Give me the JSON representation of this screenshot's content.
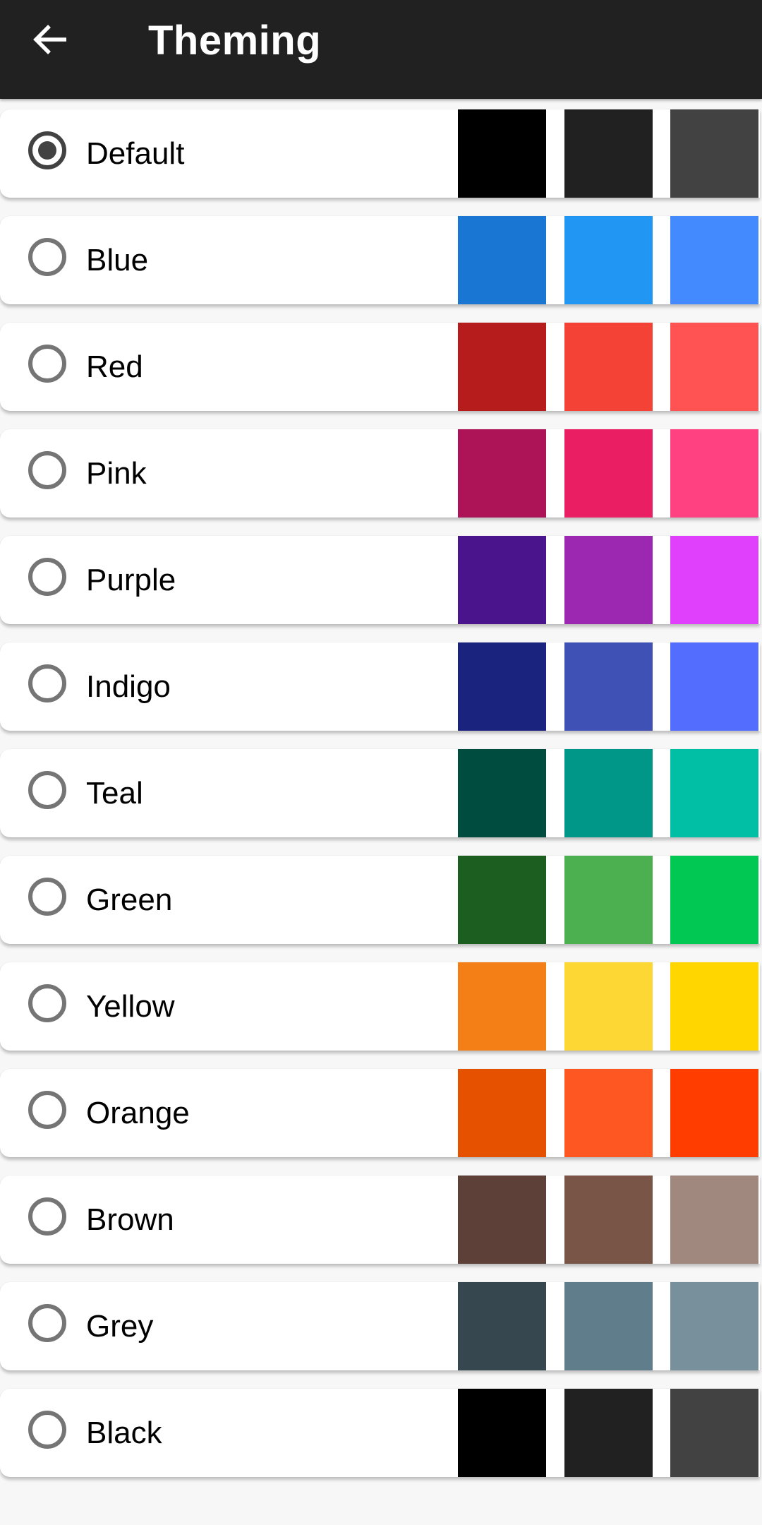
{
  "app_bar": {
    "title": "Theming",
    "back_icon": "arrow-left-icon"
  },
  "selected_theme": "Default",
  "themes": [
    {
      "name": "Default",
      "selected": true,
      "colors": [
        "#000000",
        "#212121",
        "#424242"
      ]
    },
    {
      "name": "Blue",
      "selected": false,
      "colors": [
        "#1976D2",
        "#2196F3",
        "#448AFF"
      ]
    },
    {
      "name": "Red",
      "selected": false,
      "colors": [
        "#B71C1C",
        "#F44336",
        "#FF5252"
      ]
    },
    {
      "name": "Pink",
      "selected": false,
      "colors": [
        "#AD1457",
        "#E91E63",
        "#FF4081"
      ]
    },
    {
      "name": "Purple",
      "selected": false,
      "colors": [
        "#4A148C",
        "#9C27B0",
        "#E040FB"
      ]
    },
    {
      "name": "Indigo",
      "selected": false,
      "colors": [
        "#1A237E",
        "#3F51B5",
        "#536DFE"
      ]
    },
    {
      "name": "Teal",
      "selected": false,
      "colors": [
        "#004D40",
        "#009688",
        "#00BFA5"
      ]
    },
    {
      "name": "Green",
      "selected": false,
      "colors": [
        "#1B5E20",
        "#4CAF50",
        "#00C853"
      ]
    },
    {
      "name": "Yellow",
      "selected": false,
      "colors": [
        "#F57F17",
        "#FDD835",
        "#FFD600"
      ]
    },
    {
      "name": "Orange",
      "selected": false,
      "colors": [
        "#E65100",
        "#FF5722",
        "#FF3D00"
      ]
    },
    {
      "name": "Brown",
      "selected": false,
      "colors": [
        "#5D4037",
        "#795548",
        "#A1887F"
      ]
    },
    {
      "name": "Grey",
      "selected": false,
      "colors": [
        "#37474F",
        "#607D8B",
        "#78909C"
      ]
    },
    {
      "name": "Black",
      "selected": false,
      "colors": [
        "#000000",
        "#212121",
        "#424242"
      ]
    }
  ]
}
